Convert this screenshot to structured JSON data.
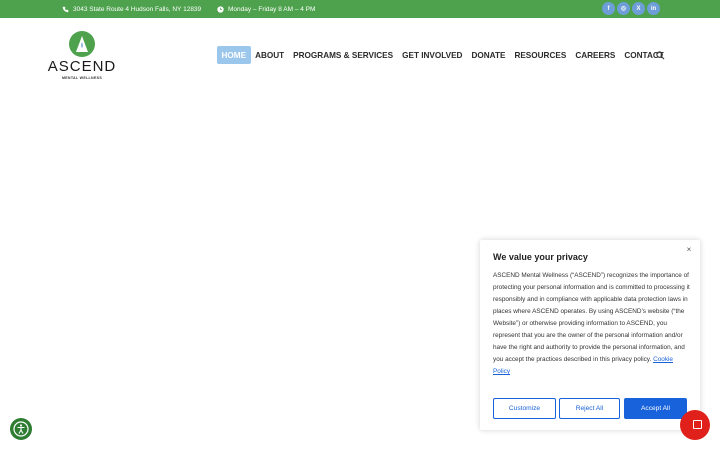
{
  "topbar": {
    "address": "3043 State Route 4 Hudson Falls, NY 12839",
    "hours": "Monday – Friday 8 AM – 4 PM",
    "social": [
      "f",
      "◎",
      "X",
      "in"
    ]
  },
  "logo": {
    "name": "ASCEND",
    "subtitle": "MENTAL WELLNESS"
  },
  "nav": {
    "items": [
      "HOME",
      "ABOUT",
      "PROGRAMS & SERVICES",
      "GET INVOLVED",
      "DONATE",
      "RESOURCES",
      "CAREERS",
      "CONTACT"
    ]
  },
  "cookie": {
    "title": "We value your privacy",
    "body": "ASCEND Mental Wellness (“ASCEND”) recognizes the importance of protecting your personal information and is committed to processing it responsibly and in compliance with applicable data protection laws in places where ASCEND operates. By using ASCEND’s website (“the Website”) or otherwise providing information to ASCEND, you represent that you are the owner of the personal information and/or have the right and authority to provide the personal information, and you accept the practices described in this privacy policy.",
    "link": "Cookie Policy",
    "customize": "Customize",
    "reject": "Reject All",
    "accept": "Accept All"
  },
  "colors": {
    "topbar": "#4ea24e",
    "accent": "#1863dc",
    "nav_active": "#9cc7ec",
    "chat": "#e0211b"
  }
}
